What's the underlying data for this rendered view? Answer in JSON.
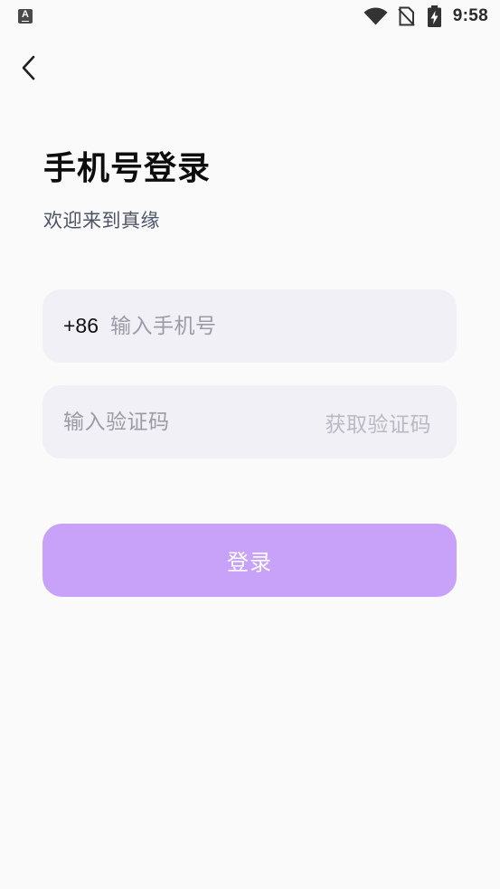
{
  "status_bar": {
    "time": "9:58",
    "notification_glyph": "A",
    "icons": [
      "app-notification-icon",
      "wifi-icon",
      "no-sim-icon",
      "battery-charging-icon"
    ]
  },
  "nav": {
    "back_icon": "chevron-left-icon"
  },
  "header": {
    "title": "手机号登录",
    "subtitle": "欢迎来到真缘"
  },
  "phone_field": {
    "country_code": "+86",
    "placeholder": "输入手机号",
    "value": ""
  },
  "code_field": {
    "placeholder": "输入验证码",
    "value": "",
    "get_code_label": "获取验证码"
  },
  "login_button": {
    "label": "登录"
  },
  "colors": {
    "background": "#fafafa",
    "field_background": "#f1f0f6",
    "accent": "#c8a1f8",
    "placeholder": "#9b9aa6",
    "get_code_disabled": "#bab9c3",
    "subtitle": "#4d5366"
  }
}
